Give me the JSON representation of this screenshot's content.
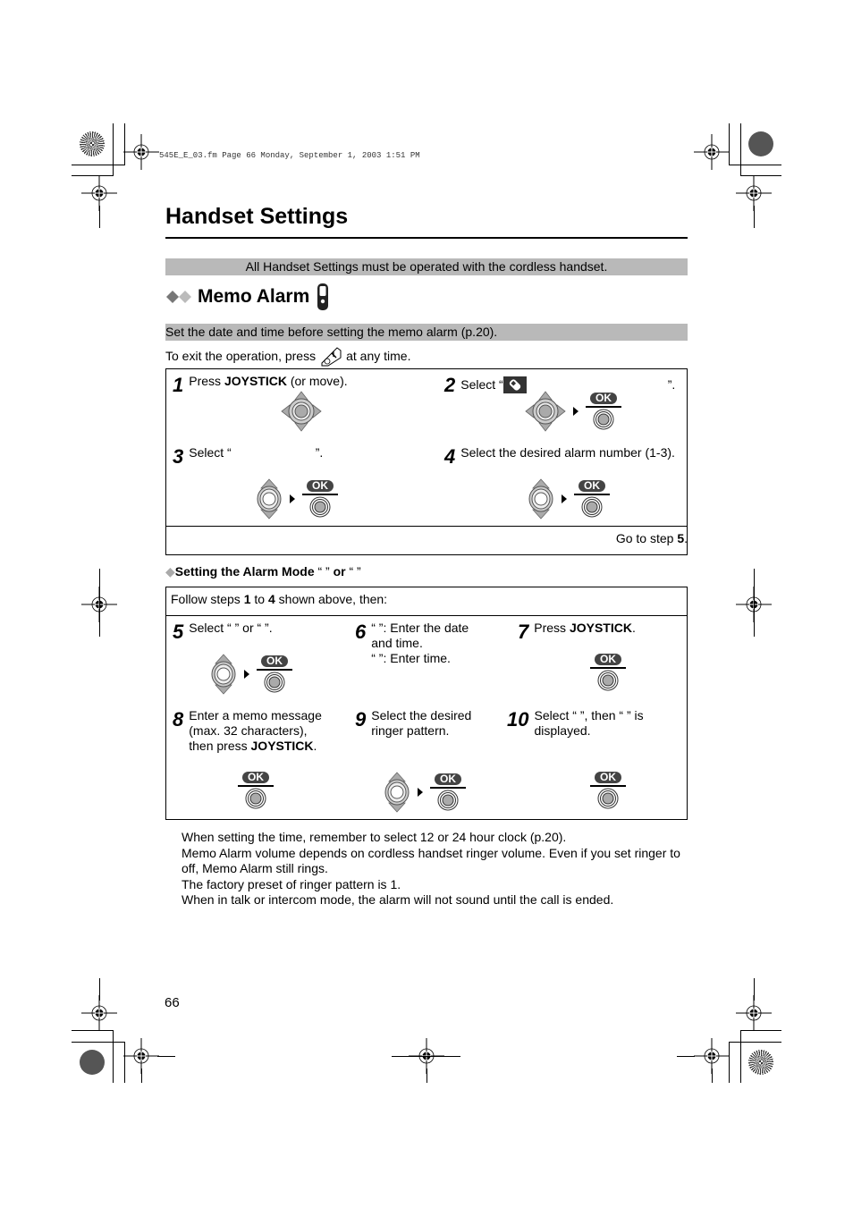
{
  "print_header": "545E_E_03.fm  Page 66  Monday, September 1, 2003  1:51 PM",
  "page_title": "Handset Settings",
  "notice": "All Handset Settings must be operated with the cordless handset.",
  "section": {
    "title": "Memo Alarm",
    "prereq": "Set the date and time before setting the memo alarm (p.20).",
    "exit_before": "To exit the operation, press",
    "exit_after": "at any time."
  },
  "steps_a": [
    {
      "num": "1",
      "pre": "Press ",
      "bold": "JOYSTICK",
      "post": " (or move)."
    },
    {
      "num": "2",
      "pre": "Select “",
      "post": "”."
    },
    {
      "num": "3",
      "pre": "Select “",
      "post": "”."
    },
    {
      "num": "4",
      "pre": "Select the desired alarm number (1-3)."
    }
  ],
  "goto": {
    "pre": "Go to step ",
    "bold": "5",
    "post": "."
  },
  "subsection": {
    "title": "Setting the Alarm Mode",
    "quote1": "“          ”",
    "or": "or",
    "quote2": "“            ”"
  },
  "follow": {
    "pre": "Follow steps ",
    "b1": "1",
    "mid": " to ",
    "b2": "4",
    "post": " shown above, then:"
  },
  "steps_b": [
    {
      "num": "5",
      "text": "Select “          ” or “          ”."
    },
    {
      "num": "6",
      "line1": "“          ”: Enter the date and time.",
      "line2": "“          ”: Enter time."
    },
    {
      "num": "7",
      "pre": "Press ",
      "bold": "JOYSTICK",
      "post": "."
    },
    {
      "num": "8",
      "pre": "Enter a memo message (max. 32 characters), then press ",
      "bold": "JOYSTICK",
      "post": "."
    },
    {
      "num": "9",
      "text": "Select the desired ringer pattern."
    },
    {
      "num": "10",
      "text": "Select “          ”, then “            ” is displayed."
    }
  ],
  "ok_label": "OK",
  "notes": [
    "When setting the time, remember to select 12 or 24 hour clock (p.20).",
    "Memo Alarm volume depends on cordless handset ringer volume. Even if you set ringer to off, Memo Alarm still rings.",
    "The factory preset of ringer pattern is 1.",
    "When in talk or intercom mode, the alarm will not sound until the call is ended."
  ],
  "page_number": "66"
}
